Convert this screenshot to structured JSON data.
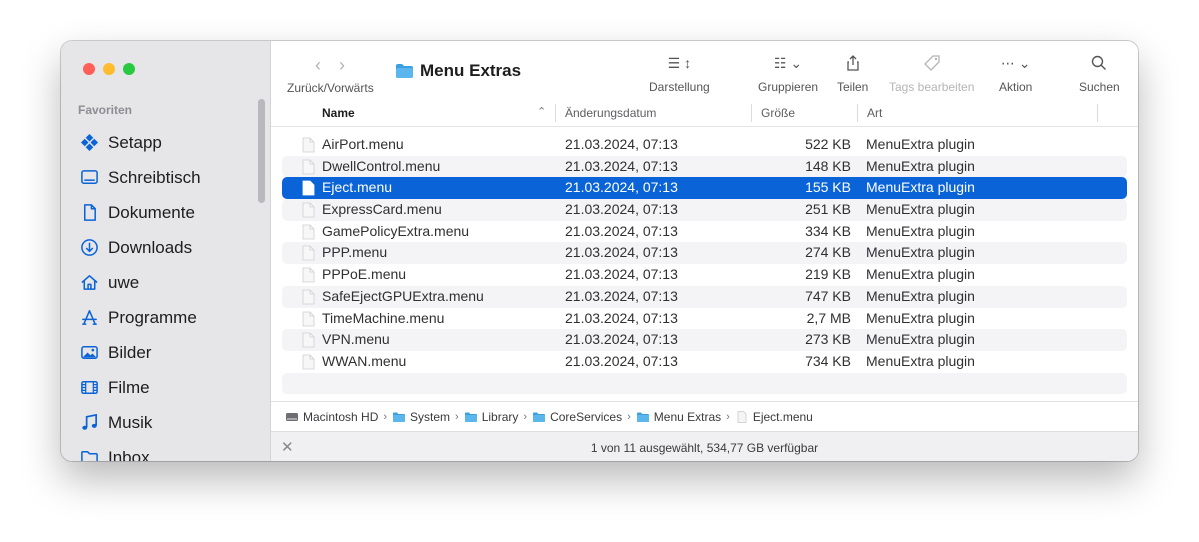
{
  "window": {
    "title": "Menu Extras"
  },
  "toolbar": {
    "nav_label": "Zurück/Vorwärts",
    "view_label": "Darstellung",
    "group_label": "Gruppieren",
    "share_label": "Teilen",
    "tags_label": "Tags bearbeiten",
    "action_label": "Aktion",
    "search_label": "Suchen"
  },
  "sidebar": {
    "section": "Favoriten",
    "items": [
      {
        "label": "Setapp",
        "icon": "setapp-icon"
      },
      {
        "label": "Schreibtisch",
        "icon": "desktop-icon"
      },
      {
        "label": "Dokumente",
        "icon": "document-icon"
      },
      {
        "label": "Downloads",
        "icon": "download-icon"
      },
      {
        "label": "uwe",
        "icon": "home-icon"
      },
      {
        "label": "Programme",
        "icon": "apps-icon"
      },
      {
        "label": "Bilder",
        "icon": "photo-icon"
      },
      {
        "label": "Filme",
        "icon": "film-icon"
      },
      {
        "label": "Musik",
        "icon": "music-icon"
      },
      {
        "label": "Inbox",
        "icon": "folder-icon"
      }
    ]
  },
  "columns": {
    "name": "Name",
    "date": "Änderungsdatum",
    "size": "Größe",
    "kind": "Art"
  },
  "files": [
    {
      "name": "AirPort.menu",
      "date": "21.03.2024, 07:13",
      "size": "522 KB",
      "kind": "MenuExtra plugin"
    },
    {
      "name": "DwellControl.menu",
      "date": "21.03.2024, 07:13",
      "size": "148 KB",
      "kind": "MenuExtra plugin"
    },
    {
      "name": "Eject.menu",
      "date": "21.03.2024, 07:13",
      "size": "155 KB",
      "kind": "MenuExtra plugin"
    },
    {
      "name": "ExpressCard.menu",
      "date": "21.03.2024, 07:13",
      "size": "251 KB",
      "kind": "MenuExtra plugin"
    },
    {
      "name": "GamePolicyExtra.menu",
      "date": "21.03.2024, 07:13",
      "size": "334 KB",
      "kind": "MenuExtra plugin"
    },
    {
      "name": "PPP.menu",
      "date": "21.03.2024, 07:13",
      "size": "274 KB",
      "kind": "MenuExtra plugin"
    },
    {
      "name": "PPPoE.menu",
      "date": "21.03.2024, 07:13",
      "size": "219 KB",
      "kind": "MenuExtra plugin"
    },
    {
      "name": "SafeEjectGPUExtra.menu",
      "date": "21.03.2024, 07:13",
      "size": "747 KB",
      "kind": "MenuExtra plugin"
    },
    {
      "name": "TimeMachine.menu",
      "date": "21.03.2024, 07:13",
      "size": "2,7 MB",
      "kind": "MenuExtra plugin"
    },
    {
      "name": "VPN.menu",
      "date": "21.03.2024, 07:13",
      "size": "273 KB",
      "kind": "MenuExtra plugin"
    },
    {
      "name": "WWAN.menu",
      "date": "21.03.2024, 07:13",
      "size": "734 KB",
      "kind": "MenuExtra plugin"
    }
  ],
  "selected_file": "Eject.menu",
  "path": [
    {
      "label": "Macintosh HD",
      "icon": "disk-icon"
    },
    {
      "label": "System",
      "icon": "folder-icon"
    },
    {
      "label": "Library",
      "icon": "folder-icon"
    },
    {
      "label": "CoreServices",
      "icon": "folder-icon"
    },
    {
      "label": "Menu Extras",
      "icon": "folder-icon"
    },
    {
      "label": "Eject.menu",
      "icon": "file-icon"
    }
  ],
  "status": "1 von 11 ausgewählt, 534,77 GB verfügbar",
  "colors": {
    "selection": "#0a64d8",
    "folder": "#3aa0e0",
    "accent_icon": "#0a64d8"
  }
}
